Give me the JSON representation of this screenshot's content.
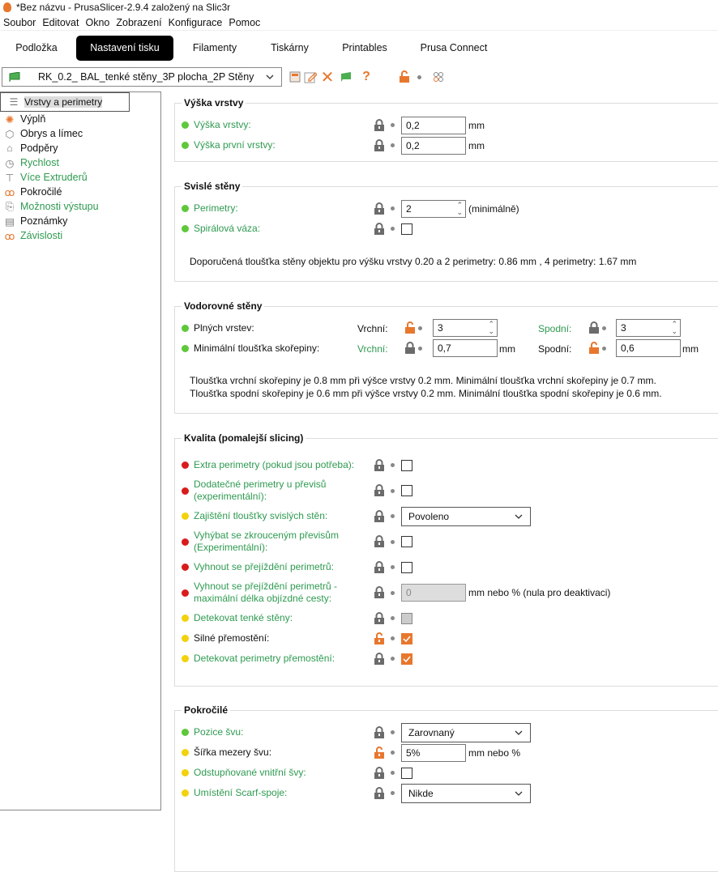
{
  "window": {
    "title": "*Bez názvu - PrusaSlicer-2.9.4 založený na Slic3r"
  },
  "menu": [
    "Soubor",
    "Editovat",
    "Okno",
    "Zobrazení",
    "Konfigurace",
    "Pomoc"
  ],
  "tabs": [
    {
      "label": "Podložka",
      "active": false
    },
    {
      "label": "Nastavení tisku",
      "active": true
    },
    {
      "label": "Filamenty",
      "active": false
    },
    {
      "label": "Tiskárny",
      "active": false
    },
    {
      "label": "Printables",
      "active": false
    },
    {
      "label": "Prusa Connect",
      "active": false
    }
  ],
  "preset": {
    "name": "RK_0.2_ BAL_tenké stěny_3P plocha_2P Stěny",
    "help": "?"
  },
  "colors": {
    "green_dot": "#5ec83a",
    "yellow_dot": "#f2d20c",
    "red_dot": "#d81c1c",
    "green_text": "#2e9a50",
    "orange": "#e8772e",
    "lock_grey": "#6b6b6b"
  },
  "sidebar": [
    {
      "label": "Vrstvy a perimetry",
      "icon": "layers-icon",
      "color": "black",
      "selected": true
    },
    {
      "label": "Výplň",
      "icon": "infill-icon",
      "color": "black"
    },
    {
      "label": "Obrys a límec",
      "icon": "skirt-icon",
      "color": "black"
    },
    {
      "label": "Podpěry",
      "icon": "support-icon",
      "color": "black"
    },
    {
      "label": "Rychlost",
      "icon": "speed-icon",
      "color": "green"
    },
    {
      "label": "Více Extruderů",
      "icon": "extruder-icon",
      "color": "green"
    },
    {
      "label": "Pokročilé",
      "icon": "wrench-icon",
      "color": "black"
    },
    {
      "label": "Možnosti výstupu",
      "icon": "output-icon",
      "color": "green"
    },
    {
      "label": "Poznámky",
      "icon": "notes-icon",
      "color": "black"
    },
    {
      "label": "Závislosti",
      "icon": "dependencies-icon",
      "color": "green"
    }
  ],
  "groups": {
    "layer_height": {
      "title": "Výška vrstvy",
      "rows": [
        {
          "label": "Výška vrstvy:",
          "dot": "green",
          "lc": "green",
          "lock": "locked",
          "type": "input",
          "value": "0,2",
          "unit": "mm"
        },
        {
          "label": "Výška první vrstvy:",
          "dot": "green",
          "lc": "green",
          "lock": "locked",
          "type": "input",
          "value": "0,2",
          "unit": "mm"
        }
      ]
    },
    "vertical": {
      "title": "Svislé stěny",
      "rows": [
        {
          "label": "Perimetry:",
          "dot": "green",
          "lc": "green",
          "lock": "locked",
          "type": "spin",
          "value": "2",
          "unit": "(minimálně)"
        },
        {
          "label": "Spirálová váza:",
          "dot": "green",
          "lc": "green",
          "lock": "locked",
          "type": "checkbox",
          "checked": false
        }
      ],
      "note": "Doporučená tloušťka stěny objektu pro výšku vrstvy 0.20 a 2 perimetry: 0.86 mm , 4 perimetry: 1.67 mm"
    },
    "horizontal": {
      "title": "Vodorovné stěny",
      "solid_layers": {
        "label": "Plných vrstev:",
        "top_label": "Vrchní:",
        "top_value": "3",
        "bottom_label": "Spodní:",
        "bottom_value": "3"
      },
      "min_shell": {
        "label": "Minimální tloušťka skořepiny:",
        "top_label": "Vrchní:",
        "top_value": "0,7",
        "bottom_label": "Spodní:",
        "bottom_value": "0,6",
        "unit": "mm"
      },
      "notes": [
        "Tloušťka vrchní skořepiny je 0.8 mm při výšce vrstvy 0.2 mm. Minimální tloušťka vrchní skořepiny je 0.7 mm.",
        "Tloušťka spodní skořepiny je 0.6 mm při výšce vrstvy 0.2 mm. Minimální tloušťka spodní skořepiny je 0.6 mm."
      ]
    },
    "quality": {
      "title": "Kvalita (pomalejší slicing)",
      "rows": [
        {
          "label": "Extra perimetry (pokud jsou potřeba):",
          "dot": "red",
          "lc": "green",
          "lock": "locked",
          "type": "checkbox",
          "checked": false
        },
        {
          "label": "Dodatečné perimetry u převisů (experimentální):",
          "dot": "red",
          "lc": "green",
          "lock": "locked",
          "type": "checkbox",
          "checked": false,
          "tall": true
        },
        {
          "label": "Zajištění tloušťky svislých stěn:",
          "dot": "yellow",
          "lc": "green",
          "lock": "locked",
          "type": "select",
          "value": "Povoleno"
        },
        {
          "label": "Vyhýbat se zkrouceným převisům (Experimentální):",
          "dot": "red",
          "lc": "green",
          "lock": "locked",
          "type": "checkbox",
          "checked": false,
          "tall": true
        },
        {
          "label": "Vyhnout se přejíždění perimetrů:",
          "dot": "red",
          "lc": "green",
          "lock": "locked",
          "type": "checkbox",
          "checked": false
        },
        {
          "label": "Vyhnout se přejíždění perimetrů - maximální délka objízdné cesty:",
          "dot": "red",
          "lc": "green",
          "lock": "locked",
          "type": "input",
          "value": "0",
          "disabled": true,
          "unit": "mm nebo % (nula pro deaktivaci)",
          "tall": true
        },
        {
          "label": "Detekovat tenké stěny:",
          "dot": "yellow",
          "lc": "green",
          "lock": "locked",
          "type": "checkbox",
          "checked": false,
          "grey": true
        },
        {
          "label": "Silné přemostění:",
          "dot": "yellow",
          "lc": "black",
          "lock": "unlocked",
          "type": "checkbox",
          "checked": true
        },
        {
          "label": "Detekovat perimetry přemostění:",
          "dot": "yellow",
          "lc": "green",
          "lock": "locked",
          "type": "checkbox",
          "checked": true
        }
      ]
    },
    "advanced": {
      "title": "Pokročilé",
      "rows": [
        {
          "label": "Pozice švu:",
          "dot": "green",
          "lc": "green",
          "lock": "locked",
          "type": "select",
          "value": "Zarovnaný"
        },
        {
          "label": "Šířka mezery švu:",
          "dot": "yellow",
          "lc": "black",
          "lock": "unlocked",
          "type": "input",
          "value": "5%",
          "unit": "mm nebo %"
        },
        {
          "label": "Odstupňované vnitřní švy:",
          "dot": "yellow",
          "lc": "green",
          "lock": "locked",
          "type": "checkbox",
          "checked": false
        },
        {
          "label": "Umístění Scarf-spoje:",
          "dot": "yellow",
          "lc": "green",
          "lock": "locked",
          "type": "select",
          "value": "Nikde"
        }
      ]
    }
  }
}
